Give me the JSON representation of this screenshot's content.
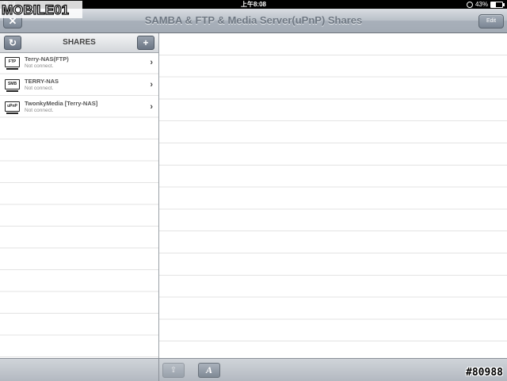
{
  "status_bar": {
    "device": "iPad",
    "time": "上午8:08",
    "battery": "43%",
    "battery_level": 0.43
  },
  "watermark": {
    "logo": "MOBILE01",
    "id": "#80988"
  },
  "title_bar": {
    "title": "SAMBA & FTP & Media Server(uPnP) Shares",
    "close_icon": "close-icon",
    "edit_label": "Edit"
  },
  "sidebar": {
    "title": "SHARES",
    "refresh_icon": "refresh-icon",
    "add_icon": "plus-icon",
    "items": [
      {
        "icon": "FTP",
        "name": "Terry-NAS(FTP)",
        "status": "Not connect."
      },
      {
        "icon": "SMB",
        "name": "TERRY-NAS",
        "status": "Not connect."
      },
      {
        "icon": "uPnP",
        "name": "TwonkyMedia [Terry-NAS]",
        "status": "Not connect."
      }
    ]
  },
  "toolbar": {
    "share_icon": "share-icon",
    "font_label": "A"
  },
  "colors": {
    "title_text": "#6e7782",
    "bar_gradient_top": "#d9dde2",
    "bar_gradient_bottom": "#a3abb5"
  }
}
